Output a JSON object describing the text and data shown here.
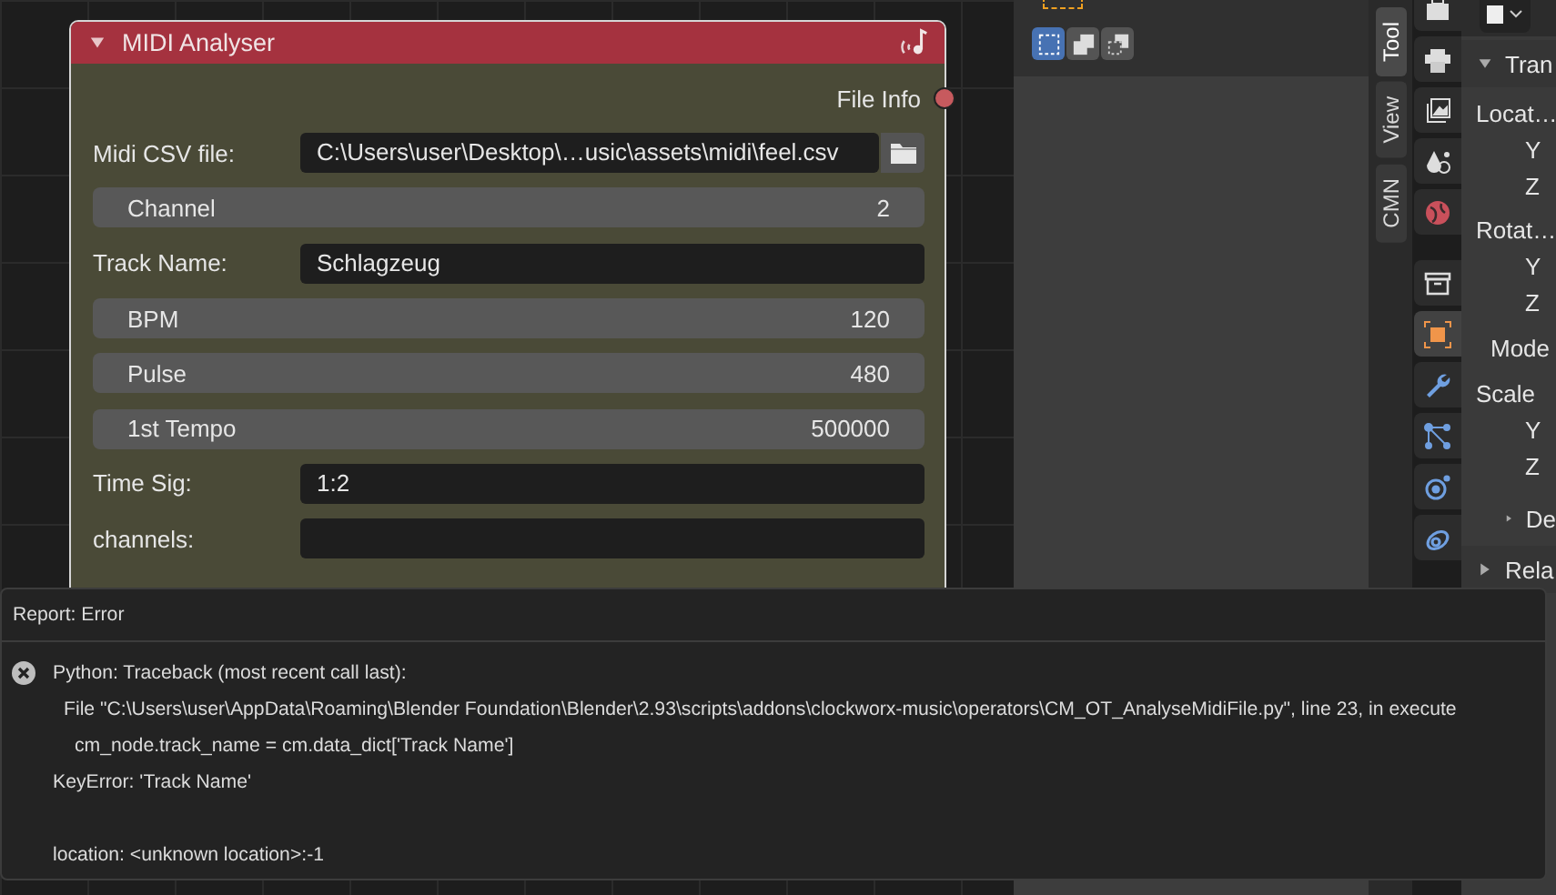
{
  "node": {
    "title": "MIDI Analyser",
    "expanded": true,
    "outputs": [
      {
        "label": "File Info"
      }
    ],
    "rows": [
      {
        "kind": "file",
        "label": "Midi CSV file:",
        "value": "C:\\Users\\user\\Desktop\\…usic\\assets\\midi\\feel.csv"
      },
      {
        "kind": "number",
        "label": "Channel",
        "value": "2"
      },
      {
        "kind": "text",
        "label": "Track Name:",
        "value": "Schlagzeug"
      },
      {
        "kind": "number",
        "label": "BPM",
        "value": "120"
      },
      {
        "kind": "number",
        "label": "Pulse",
        "value": "480"
      },
      {
        "kind": "number",
        "label": "1st Tempo",
        "value": "500000"
      },
      {
        "kind": "text",
        "label": "Time Sig:",
        "value": "1:2"
      },
      {
        "kind": "text",
        "label": "channels:"
      }
    ]
  },
  "toolbar": {
    "selection_modes": [
      {
        "kind": "set",
        "selected": true
      },
      {
        "kind": "extend",
        "selected": false
      },
      {
        "kind": "subtract",
        "selected": false
      }
    ]
  },
  "sidebar_tabs": [
    {
      "label": "Tool",
      "selected": true
    },
    {
      "label": "View",
      "selected": false
    },
    {
      "label": "CMN",
      "selected": false
    }
  ],
  "properties_tabs": [
    {
      "kind": "tool",
      "selected": false
    },
    {
      "kind": "render",
      "selected": false
    },
    {
      "kind": "output",
      "selected": false
    },
    {
      "kind": "view_layer",
      "selected": false
    },
    {
      "kind": "world",
      "selected": false
    },
    {
      "kind": "collection",
      "selected": false
    },
    {
      "kind": "object",
      "selected": true
    },
    {
      "kind": "modifiers",
      "selected": false
    },
    {
      "kind": "particles",
      "selected": false
    },
    {
      "kind": "physics",
      "selected": false
    },
    {
      "kind": "constraints",
      "selected": false
    }
  ],
  "properties": {
    "items": [
      {
        "kind": "header",
        "text": "Tran",
        "expanded": true
      },
      {
        "kind": "label",
        "text": "Locat…"
      },
      {
        "kind": "axis",
        "text": "Y"
      },
      {
        "kind": "axis",
        "text": "Z"
      },
      {
        "kind": "label",
        "text": "Rotat…"
      },
      {
        "kind": "axis",
        "text": "Y"
      },
      {
        "kind": "axis",
        "text": "Z"
      },
      {
        "kind": "field",
        "text": "Mode"
      },
      {
        "kind": "label",
        "text": "Scale"
      },
      {
        "kind": "axis",
        "text": "Y"
      },
      {
        "kind": "axis",
        "text": "Z"
      },
      {
        "kind": "subheader",
        "text": "De",
        "expanded": false
      },
      {
        "kind": "header",
        "text": "Rela",
        "expanded": false
      }
    ]
  },
  "report": {
    "title": "Report: Error",
    "lines": [
      {
        "kind": "error",
        "text": "Python: Traceback (most recent call last):"
      },
      {
        "kind": "indent1",
        "text": "File \"C:\\Users\\user\\AppData\\Roaming\\Blender Foundation\\Blender\\2.93\\scripts\\addons\\clockworx-music\\operators\\CM_OT_AnalyseMidiFile.py\", line 23, in execute"
      },
      {
        "kind": "indent2",
        "text": "cm_node.track_name = cm.data_dict['Track Name']"
      },
      {
        "kind": "plain",
        "text": "KeyError: 'Track Name'"
      },
      {
        "kind": "spaced",
        "text": "location: <unknown location>:-1"
      }
    ]
  }
}
